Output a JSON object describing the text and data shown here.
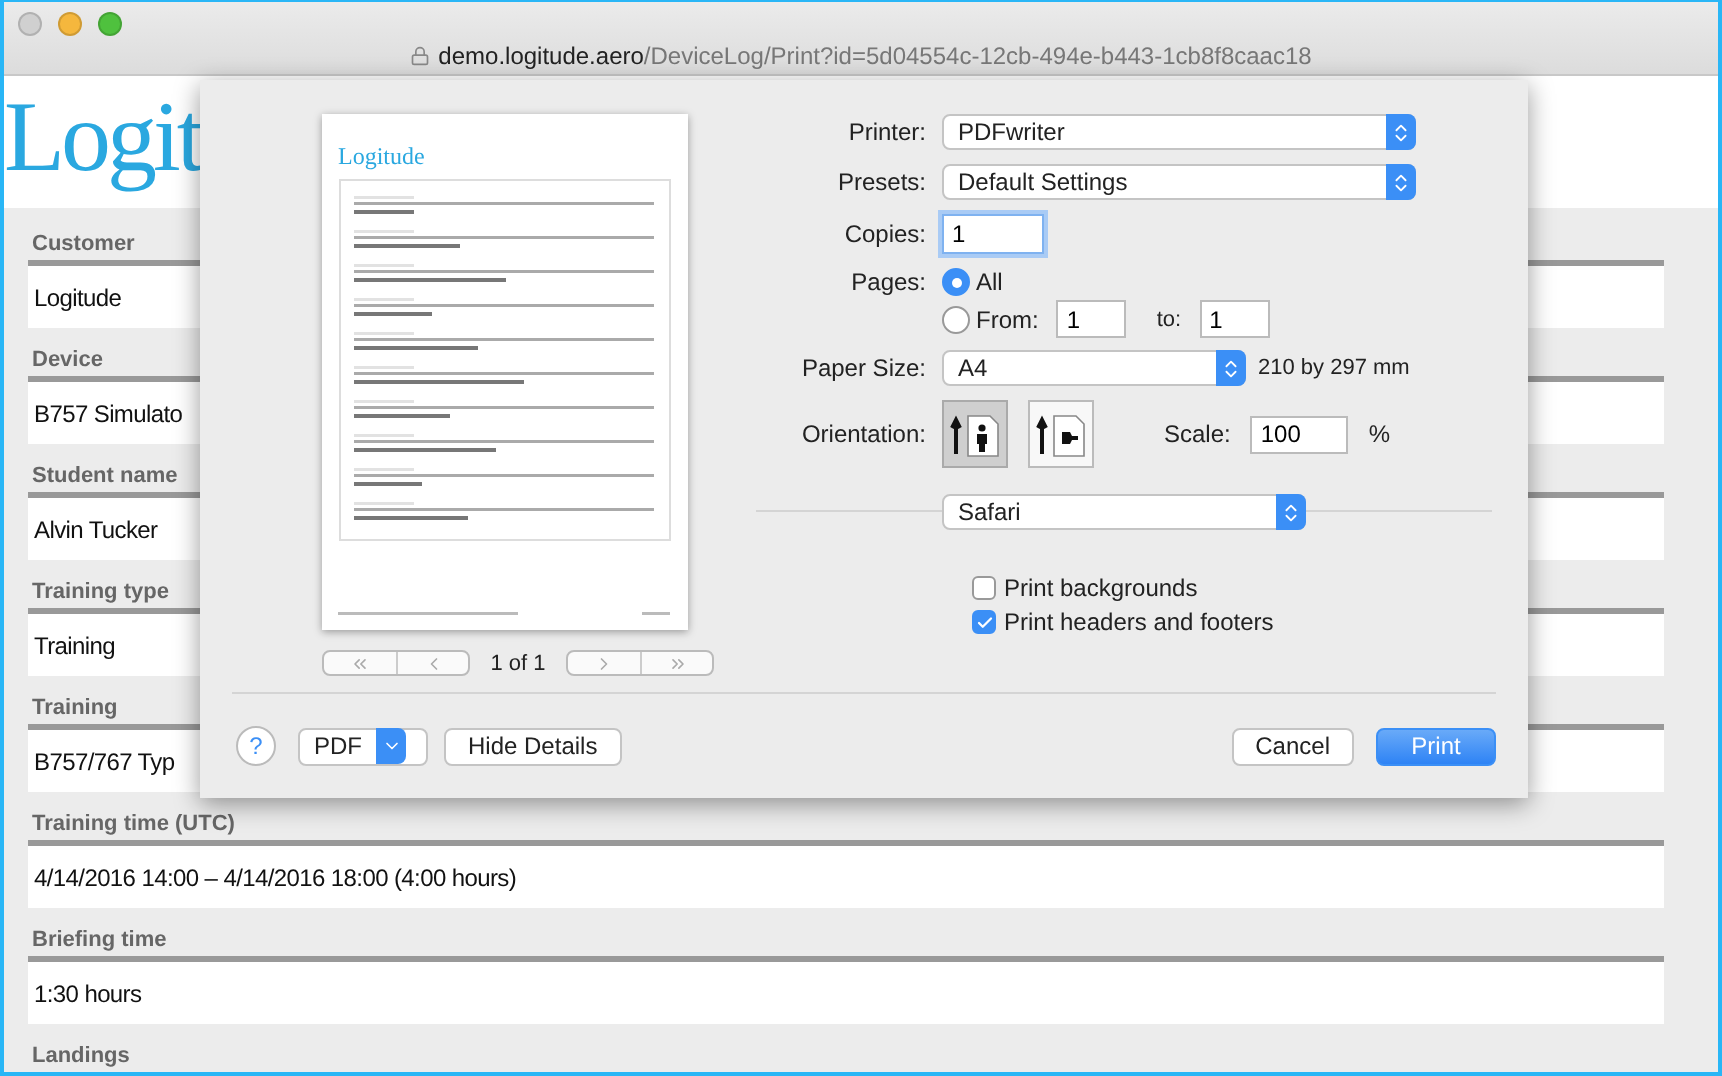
{
  "browser": {
    "url_host": "demo.logitude.aero",
    "url_path": "/DeviceLog/Print?id=5d04554c-12cb-494e-b443-1cb8f8caac18"
  },
  "page": {
    "logo": "Logit",
    "fields": [
      {
        "label": "Customer",
        "value": "Logitude"
      },
      {
        "label": "Device",
        "value": "B757 Simulato"
      },
      {
        "label": "Student name",
        "value": "Alvin Tucker"
      },
      {
        "label": "Training type",
        "value": "Training"
      },
      {
        "label": "Training",
        "value": "B757/767 Typ"
      },
      {
        "label": "Training time (UTC)",
        "value": "4/14/2016 14:00 – 4/14/2016 18:00 (4:00 hours)"
      },
      {
        "label": "Briefing time",
        "value": "1:30 hours"
      },
      {
        "label": "Landings"
      }
    ]
  },
  "print_dialog": {
    "preview": {
      "logo": "Logitude",
      "page_indicator": "1 of 1"
    },
    "printer": {
      "label": "Printer:",
      "value": "PDFwriter"
    },
    "presets": {
      "label": "Presets:",
      "value": "Default Settings"
    },
    "copies": {
      "label": "Copies:",
      "value": "1"
    },
    "pages": {
      "label": "Pages:",
      "options": [
        {
          "label": "All",
          "selected": true
        },
        {
          "label": "From:",
          "selected": false
        }
      ],
      "from": "1",
      "to_label": "to:",
      "to": "1"
    },
    "paper_size": {
      "label": "Paper Size:",
      "value": "A4",
      "dimensions": "210 by 297 mm"
    },
    "orientation": {
      "label": "Orientation:",
      "options": [
        {
          "kind": "portrait",
          "selected": true
        },
        {
          "kind": "landscape",
          "selected": false
        }
      ]
    },
    "scale": {
      "label": "Scale:",
      "value": "100",
      "unit": "%"
    },
    "app_menu": "Safari",
    "checkboxes": [
      {
        "label": "Print backgrounds",
        "checked": false
      },
      {
        "label": "Print headers and footers",
        "checked": true
      }
    ],
    "pdf_button": "PDF",
    "hide_details_button": "Hide Details",
    "cancel_button": "Cancel",
    "print_button": "Print",
    "help_button": "?"
  }
}
